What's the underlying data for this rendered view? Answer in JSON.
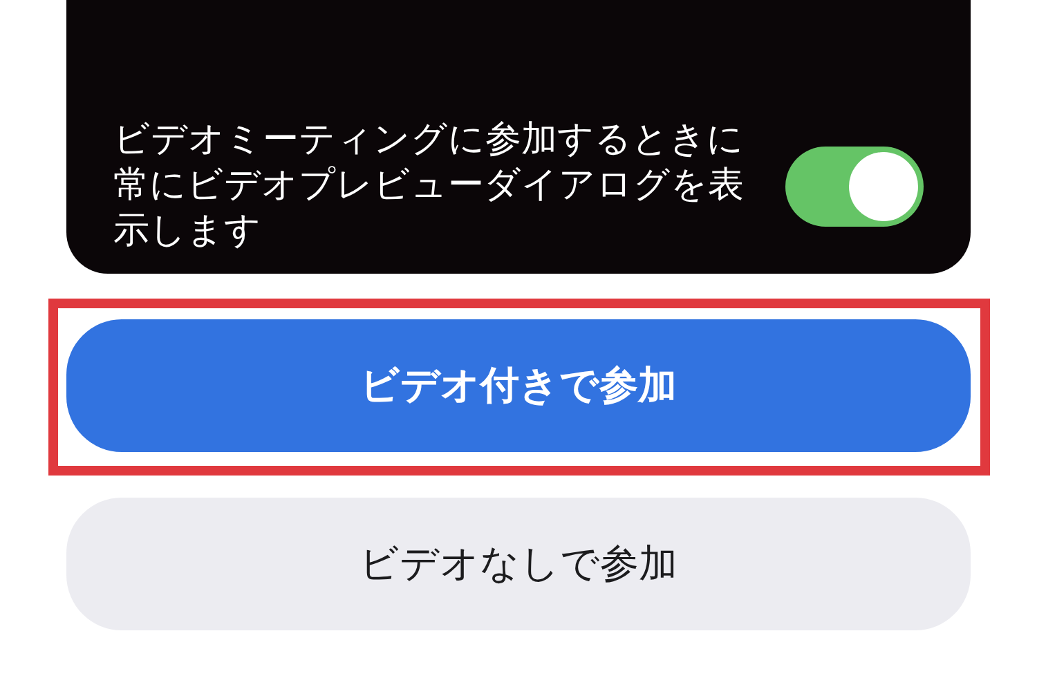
{
  "preview_card": {
    "setting": {
      "label": "ビデオミーティングに参加するときに常にビデオプレビューダイアログを表示します",
      "on": true
    }
  },
  "buttons": [
    {
      "label": "ビデオ付きで参加",
      "kind": "primary",
      "highlighted": true
    },
    {
      "label": "ビデオなしで参加",
      "kind": "secondary",
      "highlighted": false
    }
  ]
}
